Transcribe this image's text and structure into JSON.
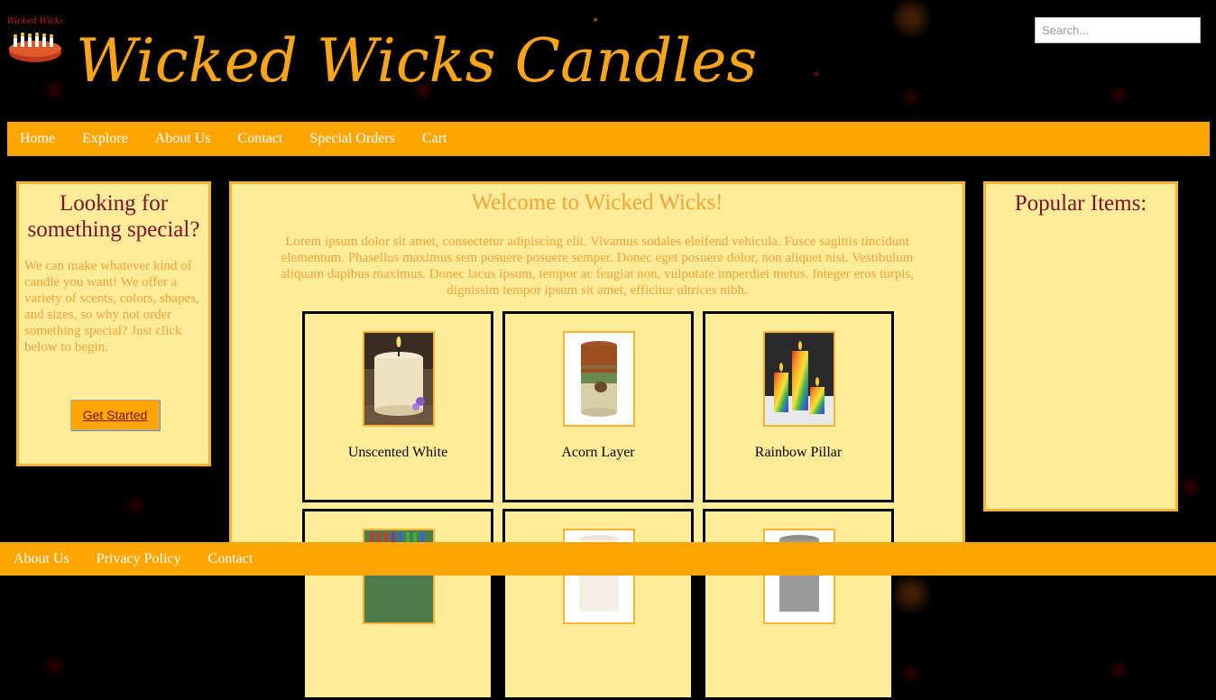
{
  "header": {
    "logo_text": "Wicked Wicks",
    "site_title": "Wicked Wicks Candles",
    "search_placeholder": "Search..."
  },
  "nav": {
    "items": [
      "Home",
      "Explore",
      "About Us",
      "Contact",
      "Special Orders",
      "Cart"
    ]
  },
  "left_panel": {
    "heading": "Looking for something special?",
    "body": "We can make whatever kind of candle you want! We offer a variety of scents, colors, shapes, and sizes, so why not order something special? Just click below to begin.",
    "button_label": "Get Started"
  },
  "main": {
    "heading": "Welcome to Wicked Wicks!",
    "intro": "Lorem ipsum dolor sit amet, consectetur adipiscing elit. Vivamus sodales eleifend vehicula. Fusce sagittis tincidunt elementum. Phasellus maximus sem posuere posuere semper. Donec eget posuere dolor, non aliquet nisi. Vestibulum aliquam dapibus maximus. Donec lacus ipsum, tempor ac feugiat non, vulputate imperdiet metus. Integer eros turpis, dignissim tempor ipsum sit amet, efficitur ultrices nibh.",
    "products": [
      {
        "name": "Unscented White"
      },
      {
        "name": "Acorn Layer"
      },
      {
        "name": "Rainbow Pillar"
      },
      {
        "name": ""
      },
      {
        "name": ""
      },
      {
        "name": ""
      }
    ]
  },
  "right_panel": {
    "heading": "Popular Items:"
  },
  "footer": {
    "links": [
      "About Us",
      "Privacy Policy",
      "Contact"
    ]
  },
  "colors": {
    "accent": "#FFA500",
    "title": "#F9A51A",
    "panel_bg": "#FFEC99",
    "panel_border": "#F9B233",
    "heading_maroon": "#7A1228"
  }
}
